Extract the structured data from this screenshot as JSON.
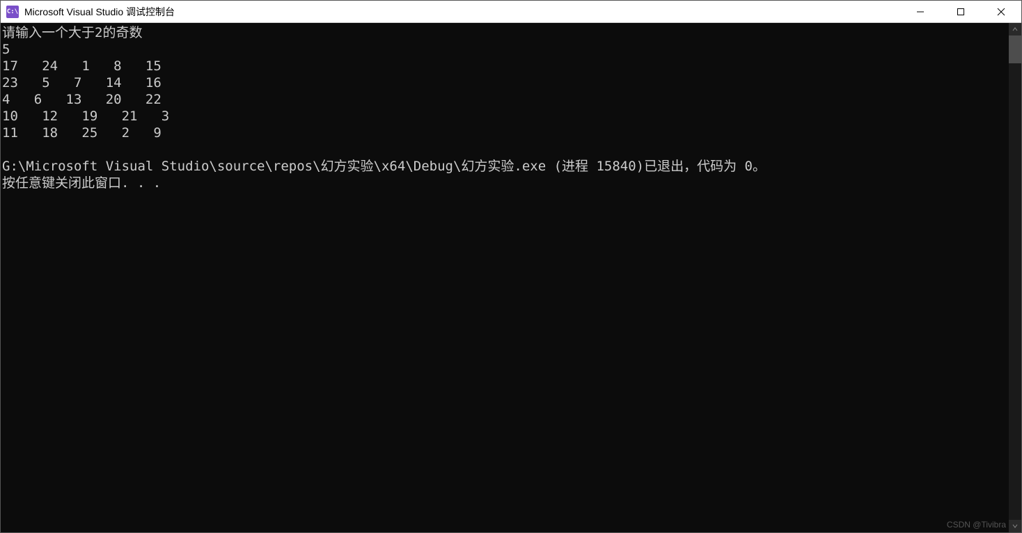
{
  "titlebar": {
    "icon_text": "C:\\",
    "title": "Microsoft Visual Studio 调试控制台"
  },
  "console": {
    "prompt": "请输入一个大于2的奇数",
    "input_value": "5",
    "matrix": [
      "17   24   1   8   15",
      "23   5   7   14   16",
      "4   6   13   20   22",
      "10   12   19   21   3",
      "11   18   25   2   9"
    ],
    "blank": "",
    "exit_line": "G:\\Microsoft Visual Studio\\source\\repos\\幻方实验\\x64\\Debug\\幻方实验.exe (进程 15840)已退出，代码为 0。",
    "press_key": "按任意键关闭此窗口. . ."
  },
  "watermark": "CSDN @Tivibra"
}
